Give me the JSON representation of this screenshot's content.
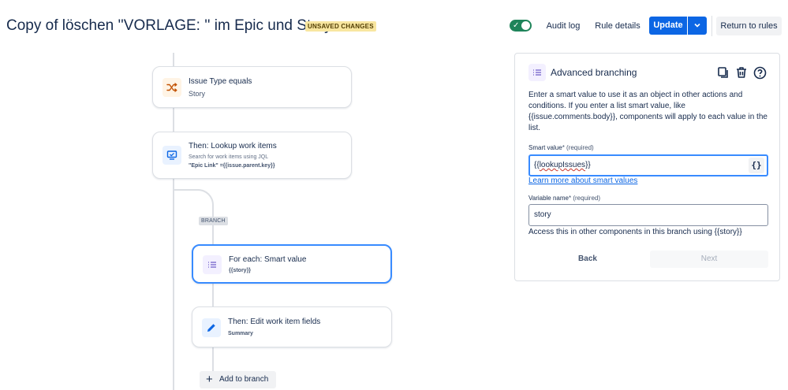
{
  "header": {
    "title": "Copy of löschen ''VORLAGE: '' im Epic und Story",
    "unsaved_badge": "UNSAVED CHANGES",
    "toggle_state": "on",
    "audit_log": "Audit log",
    "rule_details": "Rule details",
    "update": "Update",
    "return_to_rules": "Return to rules"
  },
  "flow": {
    "condition": {
      "title": "Issue Type equals",
      "value": "Story",
      "icon": "shuffle-icon"
    },
    "lookup": {
      "title": "Then: Lookup work items",
      "description": "Search for work items using JQL",
      "jql": "\"Epic Link\" ={{issue.parent.key}}",
      "icon": "monitor-icon"
    },
    "branch_label": "BRANCH",
    "for_each": {
      "title": "For each: Smart value",
      "value": "{{story}}",
      "icon": "list-icon"
    },
    "edit": {
      "title": "Then: Edit work item fields",
      "value": "Summary",
      "icon": "pencil-icon"
    },
    "add_to_branch": "Add to branch"
  },
  "panel": {
    "title": "Advanced branching",
    "description": "Enter a smart value to use it as an object in other actions and conditions. If you enter a list smart value, like {{issue.comments.body}}, components will apply to each value in the list.",
    "smart_value": {
      "label": "Smart value",
      "required": "* (required)",
      "prefix": "{{",
      "underlined": "lookupIssues",
      "suffix": "}}",
      "insert_button": "{}"
    },
    "learn_more": "Learn more about smart values",
    "variable_name": {
      "label": "Variable name",
      "required": "* (required)",
      "value": "story"
    },
    "helper_text": "Access this in other components in this branch using {{story}}",
    "back": "Back",
    "next": "Next"
  },
  "colors": {
    "primary": "#0c66e4",
    "toggle_on": "#1f845a",
    "badge_bg": "#f8e6a0",
    "selected_border": "#388bff"
  }
}
